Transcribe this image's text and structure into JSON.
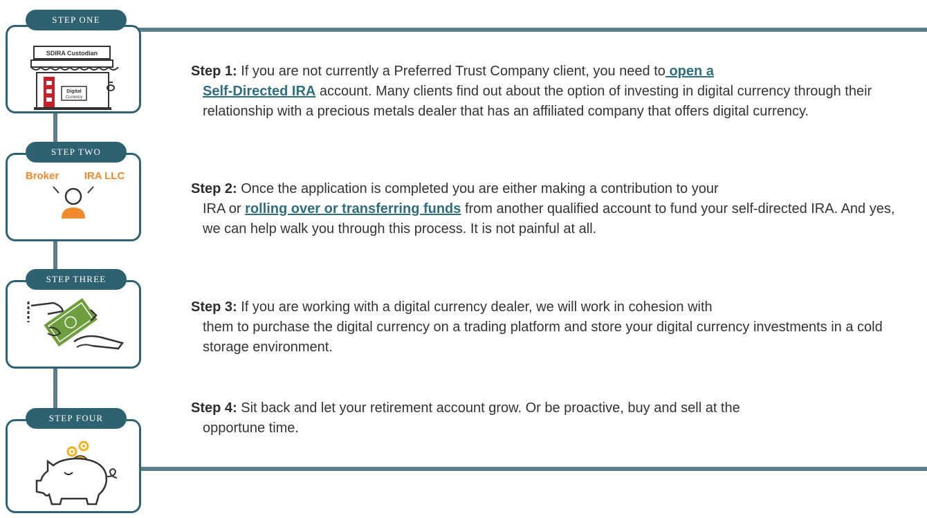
{
  "steps": [
    {
      "tab": "STEP ONE",
      "icon": "storefront-icon",
      "sign": "SDIRA Custodian",
      "door_sign_line1": "Digital",
      "door_sign_line2": "Currency"
    },
    {
      "tab": "STEP TWO",
      "icon": "person-icon",
      "label_left": "Broker",
      "label_right": "IRA LLC"
    },
    {
      "tab": "STEP THREE",
      "icon": "money-exchange-icon"
    },
    {
      "tab": "STEP FOUR",
      "icon": "piggy-bank-icon"
    }
  ],
  "paragraphs": [
    {
      "label": "Step 1:",
      "before": " If you are not currently a Preferred Trust Company client, you need to",
      "link1": " open a ",
      "link2": "Self-Directed IRA",
      "after": " account. Many clients find out about the option of investing in digital currency through their relationship with a precious metals dealer that has an affiliated company that offers digital currency."
    },
    {
      "label": "Step 2:",
      "line1": " Once the application is completed you are either making a contribution to your",
      "rest_before": "IRA or ",
      "link": "rolling over or transferring funds",
      "rest_after": " from another qualified account to fund your self-directed IRA. And yes, we can help walk you through this process. It is not painful at all."
    },
    {
      "label": "Step 3:",
      "line1": " If you are working with a digital currency dealer, we will work in cohesion with",
      "rest": "them to purchase the digital currency on a trading platform and store your digital currency investments in a cold storage environment."
    },
    {
      "label": "Step 4:",
      "line1": " Sit back and let your retirement account grow. Or be proactive, buy and sell at the",
      "rest": "opportune time."
    }
  ],
  "colors": {
    "teal": "#2f6270",
    "rail": "#5a7e8a",
    "link": "#2f6d7c",
    "orange": "#f08a2c",
    "red": "#c8202a",
    "green": "#6f9e3e",
    "gold": "#f2b21c"
  }
}
